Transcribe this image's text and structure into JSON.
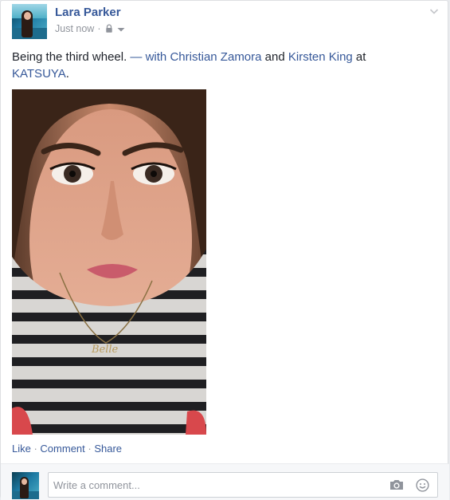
{
  "post": {
    "author": "Lara Parker",
    "time": "Just now",
    "separator": "·",
    "privacy_icon": "lock-icon",
    "audience_caret_icon": "caret-down-icon",
    "options_icon": "chevron-down-icon",
    "status": {
      "text": "Being the third wheel.",
      "dash": " — with ",
      "friend_1": "Christian Zamora",
      "and": " and ",
      "friend_2": "Kirsten King",
      "at": " at",
      "place": "KATSUYA",
      "end": "."
    },
    "photo_necklace_text": "Belle"
  },
  "actions": {
    "like": "Like",
    "comment": "Comment",
    "share": "Share",
    "sep": " · "
  },
  "comment": {
    "placeholder": "Write a comment...",
    "camera_icon": "camera-icon",
    "emoji_icon": "emoji-icon"
  },
  "colors": {
    "link": "#365899",
    "meta": "#90949c",
    "text": "#1d2129",
    "card_bg": "#ffffff",
    "comment_bg": "#f6f7f9"
  }
}
